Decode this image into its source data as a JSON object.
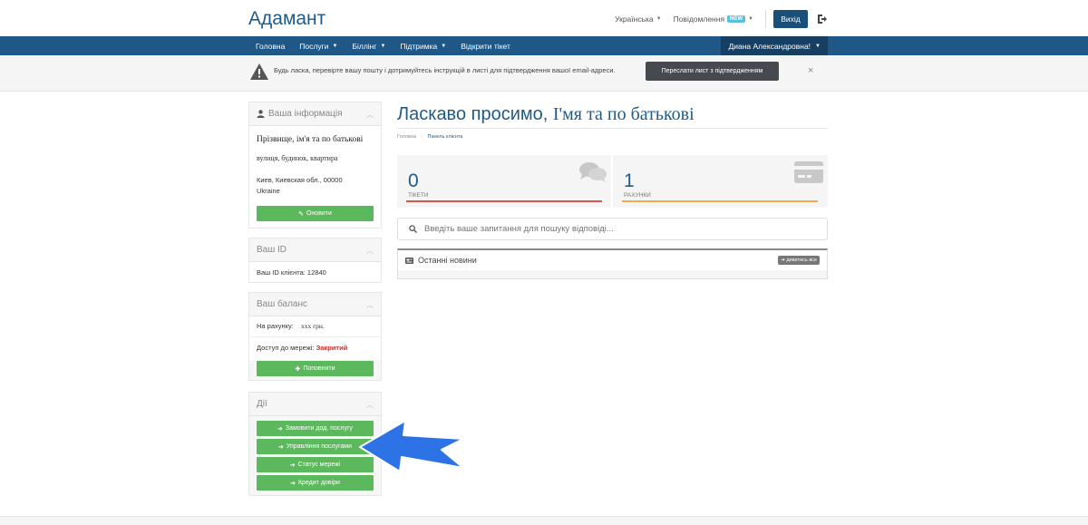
{
  "header": {
    "logo": "Адамант",
    "language": "Українська",
    "notifications": "Повідомлення",
    "new_badge": "NEW",
    "logout": "Вихід"
  },
  "nav": {
    "items": [
      {
        "label": "Головна",
        "dropdown": false
      },
      {
        "label": "Послуги",
        "dropdown": true
      },
      {
        "label": "Біллінг",
        "dropdown": true
      },
      {
        "label": "Підтримка",
        "dropdown": true
      },
      {
        "label": "Відкрити тікет",
        "dropdown": false
      }
    ],
    "user": "Диана Александровна!"
  },
  "alert": {
    "text": "Будь ласка, перевірте вашу пошту і дотримуйтесь інструкцій в листі для підтвердження вашої email-адреси.",
    "resend": "Переслати лист з підтвердженням",
    "close": "×"
  },
  "sidebar": {
    "info": {
      "title": "Ваша інформація",
      "name": "Прізвище, ім'я та по батькові",
      "street": "вулиця, будинок, квартира",
      "city": "Киев, Киевская обл., 00000",
      "country": "Ukraine",
      "update": "Оновити"
    },
    "id": {
      "title": "Ваш ID",
      "text": "Ваш ID клієнта: 12840"
    },
    "balance": {
      "title": "Ваш баланс",
      "account_label": "На рахунку:",
      "account_value": "xxx грн.",
      "access_label": "Доступ до мережі:",
      "access_value": "Закритий",
      "topup": "Поповнити"
    },
    "actions": {
      "title": "Дії",
      "buttons": [
        "Замовити дод. послугу",
        "Управління послугами",
        "Статус мережі",
        "Кредит довіри"
      ]
    }
  },
  "main": {
    "welcome": "Ласкаво просимо,",
    "welcome_name": "І'мя та по батькові",
    "breadcrumb_home": "Головна",
    "breadcrumb_current": "Панель клієнта",
    "stats": [
      {
        "value": "0",
        "label": "ТІКЕТИ",
        "color": "#d9534f"
      },
      {
        "value": "1",
        "label": "РАХУНКИ",
        "color": "#f0ad4e"
      }
    ],
    "search_placeholder": "Введіть ваше запитання для пошуку відповіді...",
    "news_title": "Останні новини",
    "view_all": "дивитись все"
  },
  "colors": {
    "brand": "#1f5786",
    "green": "#5cb85c",
    "arrow": "#2d73e6"
  }
}
